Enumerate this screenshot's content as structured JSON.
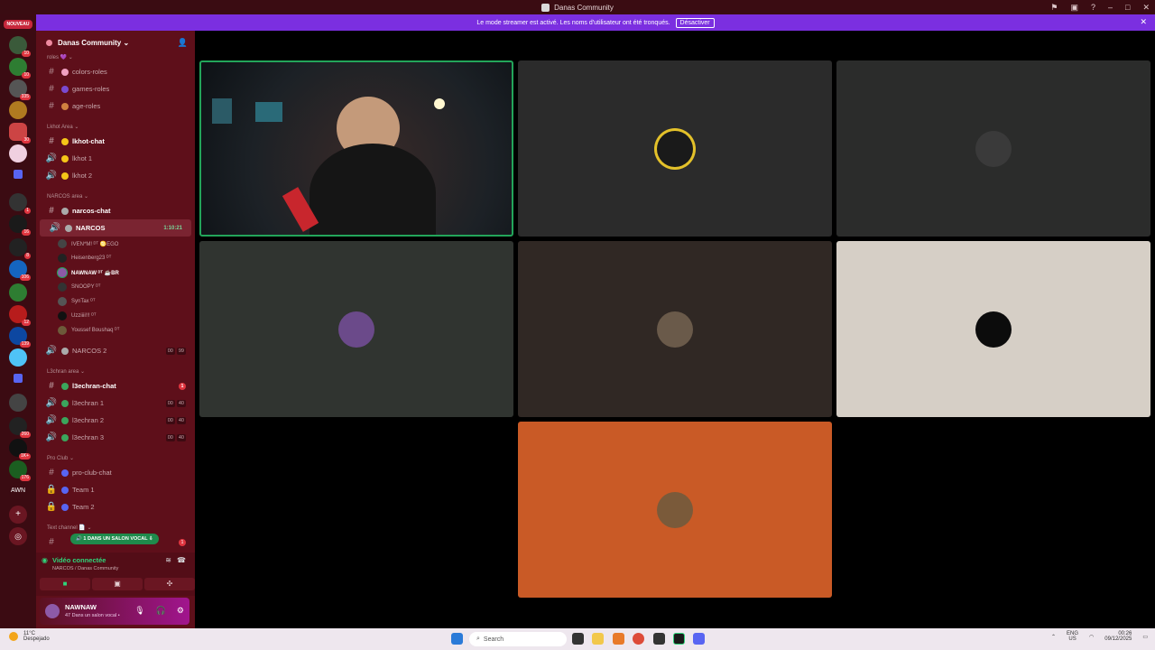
{
  "window": {
    "title": "Danas Community"
  },
  "banner": {
    "text": "Le mode streamer est activé. Les noms d'utilisateur ont été tronqués.",
    "button": "Désactiver"
  },
  "servers": {
    "nouveau": "NOUVEAU",
    "badges": [
      "10",
      "335",
      "30",
      "1",
      "8",
      "16",
      "106",
      "12",
      "139",
      "260",
      "1K+",
      "176"
    ],
    "awn": "AWN"
  },
  "guild": {
    "name": "Danas Community ⌄"
  },
  "sidebar": {
    "cat_roles": "roles 💜 ⌄",
    "colors_roles": "colors-roles",
    "games_roles": "games-roles",
    "age_roles": "age-roles",
    "cat_lkhot": "Lkhot Area ⌄",
    "lkhot_chat": "lkhot-chat",
    "lkhot1": "lkhot 1",
    "lkhot2": "lkhot 2",
    "cat_narcos": "NARCOS area ⌄",
    "narcos_chat": "narcos-chat",
    "narcos": "NARCOS",
    "narcos_time": "1:10:21",
    "members": [
      {
        "name": "IVEN*M! ᴰᵀ ♋EGO"
      },
      {
        "name": "Heisenberg23 ᴰᵀ"
      },
      {
        "name": "NAWNAW ᴰᵀ ☕BR"
      },
      {
        "name": "SNOOPY ᴰᵀ"
      },
      {
        "name": "SynTax ᴰᵀ"
      },
      {
        "name": "Uzziiii!!! ᴰᵀ"
      },
      {
        "name": "Youssef Boushaq ᴰᵀ"
      }
    ],
    "narcos2": "NARCOS 2",
    "narcos2_count": [
      "00",
      "99"
    ],
    "cat_l3chran": "L3chran area ⌄",
    "l3chran_chat": "l3echran-chat",
    "l3chran_chat_unread": "1",
    "l3chran1": "l3echran 1",
    "l3chran2": "l3echran 2",
    "l3chran3": "l3echran 3",
    "l3_count": [
      "00",
      "40"
    ],
    "cat_proclub": "Pro Club ⌄",
    "proclub_chat": "pro-club-chat",
    "team1": "Team 1",
    "team2": "Team 2",
    "cat_text": "Text channel 📄 ⌄",
    "last_unread": "1",
    "pill": "🔊 1 DANS UN SALON VOCAL ⇩"
  },
  "voice": {
    "title": "Vidéo connectée",
    "subtitle": "NARCOS / Danas Community"
  },
  "user": {
    "name": "NAWNAW",
    "status": "47 Dans un salon vocal •"
  },
  "taskbar": {
    "weather_temp": "11°C",
    "weather_desc": "Despejado",
    "search": "Search",
    "lang": "ENG",
    "region": "US",
    "time": "00:26",
    "date": "09/12/2025"
  },
  "colors": {
    "accent": "#7b2fe0",
    "sidebar": "#5e0f1a",
    "speaking": "#23a55a"
  }
}
